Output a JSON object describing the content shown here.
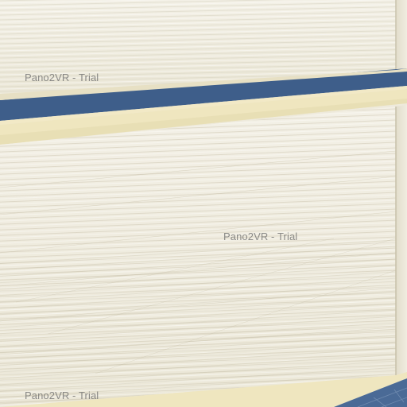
{
  "scene": {
    "description_colors": {
      "wall_cream": "#f1eee2",
      "wall_shadow": "#dcd7c6",
      "trim_yellow": "#efe6bf",
      "accent_blue": "#3e5e8a",
      "tile_blue": "#4a6a96"
    }
  },
  "watermarks": [
    {
      "text": "Pano2VR - Trial"
    },
    {
      "text": "Pano2VR - Trial"
    },
    {
      "text": "Pano2VR - Trial"
    }
  ]
}
